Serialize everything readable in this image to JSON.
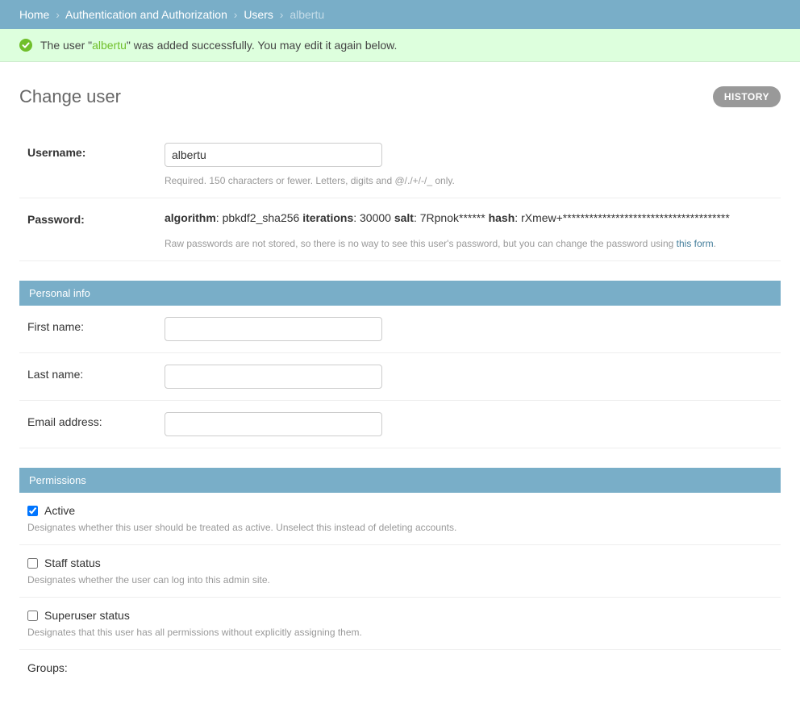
{
  "breadcrumbs": {
    "home": "Home",
    "auth": "Authentication and Authorization",
    "users": "Users",
    "current": "albertu"
  },
  "message": {
    "prefix": "The user \"",
    "username": "albertu",
    "suffix": "\" was added successfully. You may edit it again below."
  },
  "title": "Change user",
  "history_label": "HISTORY",
  "username": {
    "label": "Username:",
    "value": "albertu",
    "help": "Required. 150 characters or fewer. Letters, digits and @/./+/-/_ only."
  },
  "password": {
    "label": "Password:",
    "algorithm_label": "algorithm",
    "algorithm_value": "pbkdf2_sha256",
    "iterations_label": "iterations",
    "iterations_value": "30000",
    "salt_label": "salt",
    "salt_value": "7Rpnok******",
    "hash_label": "hash",
    "hash_value": "rXmew+**************************************",
    "help_prefix": "Raw passwords are not stored, so there is no way to see this user's password, but you can change the password using ",
    "help_link": "this form",
    "help_suffix": "."
  },
  "personal_info": {
    "heading": "Personal info",
    "first_name_label": "First name:",
    "first_name_value": "",
    "last_name_label": "Last name:",
    "last_name_value": "",
    "email_label": "Email address:",
    "email_value": ""
  },
  "permissions": {
    "heading": "Permissions",
    "active_label": "Active",
    "active_checked": true,
    "active_help": "Designates whether this user should be treated as active. Unselect this instead of deleting accounts.",
    "staff_label": "Staff status",
    "staff_checked": false,
    "staff_help": "Designates whether the user can log into this admin site.",
    "superuser_label": "Superuser status",
    "superuser_checked": false,
    "superuser_help": "Designates that this user has all permissions without explicitly assigning them.",
    "groups_label": "Groups:"
  }
}
